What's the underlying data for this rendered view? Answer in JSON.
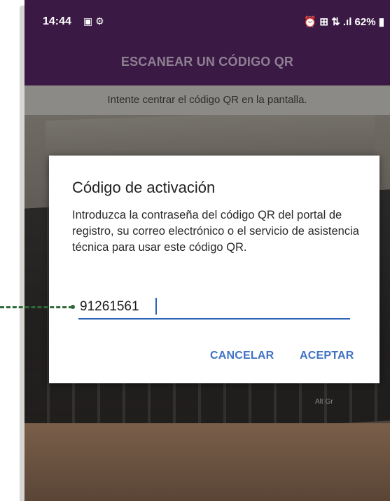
{
  "status_bar": {
    "time": "14:44",
    "left_icons": "▣ ⚙",
    "right": "⏰ ⊞ ⇅ .ıl 62% ▮"
  },
  "app_bar": {
    "title": "ESCANEAR UN CÓDIGO QR"
  },
  "hint": {
    "text": "Intente centrar el código QR en la pantalla."
  },
  "background": {
    "keyboard_label": "Alt Gr"
  },
  "dialog": {
    "title": "Código de activación",
    "message": "Introduzca la contraseña del código QR del portal de registro, su correo electrónico o el servicio de asistencia técnica para usar este código QR.",
    "input_value": "91261561",
    "cancel_label": "CANCELAR",
    "accept_label": "ACEPTAR"
  },
  "colors": {
    "app_bar": "#3a1a44",
    "accent": "#3f73c2",
    "input_underline": "#2e63b6",
    "callout": "#2f6b3a"
  }
}
